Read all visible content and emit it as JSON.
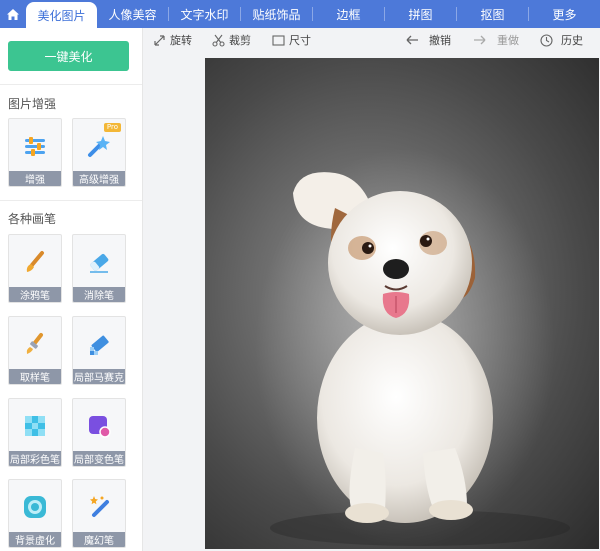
{
  "tabs": [
    {
      "label": "美化图片",
      "active": true
    },
    {
      "label": "人像美容"
    },
    {
      "label": "文字水印"
    },
    {
      "label": "贴纸饰品"
    },
    {
      "label": "边框"
    },
    {
      "label": "拼图"
    },
    {
      "label": "抠图"
    },
    {
      "label": "更多"
    }
  ],
  "sidebar": {
    "one_key_label": "一键美化",
    "enhance_title": "图片增强",
    "enhance_tools": [
      {
        "label": "增强",
        "icon": "sliders-icon"
      },
      {
        "label": "高级增强",
        "icon": "magic-wand-icon",
        "badge": "Pro"
      }
    ],
    "brush_title": "各种画笔",
    "brush_tools": [
      {
        "label": "涂鸦笔",
        "icon": "paint-brush-icon"
      },
      {
        "label": "消除笔",
        "icon": "eraser-icon"
      },
      {
        "label": "取样笔",
        "icon": "sample-brush-icon"
      },
      {
        "label": "局部马赛克",
        "icon": "mosaic-pen-icon"
      },
      {
        "label": "局部彩色笔",
        "icon": "color-grid-icon"
      },
      {
        "label": "局部变色笔",
        "icon": "color-change-icon"
      },
      {
        "label": "背景虚化",
        "icon": "blur-icon"
      },
      {
        "label": "魔幻笔",
        "icon": "magic-pen-icon"
      }
    ]
  },
  "toolbar": {
    "rotate": "旋转",
    "crop": "裁剪",
    "size": "尺寸",
    "undo": "撤销",
    "redo": "重做",
    "history": "历史"
  },
  "colors": {
    "brand": "#4d79d9",
    "one_key": "#3cc591",
    "label_bg": "#8e97a8"
  }
}
